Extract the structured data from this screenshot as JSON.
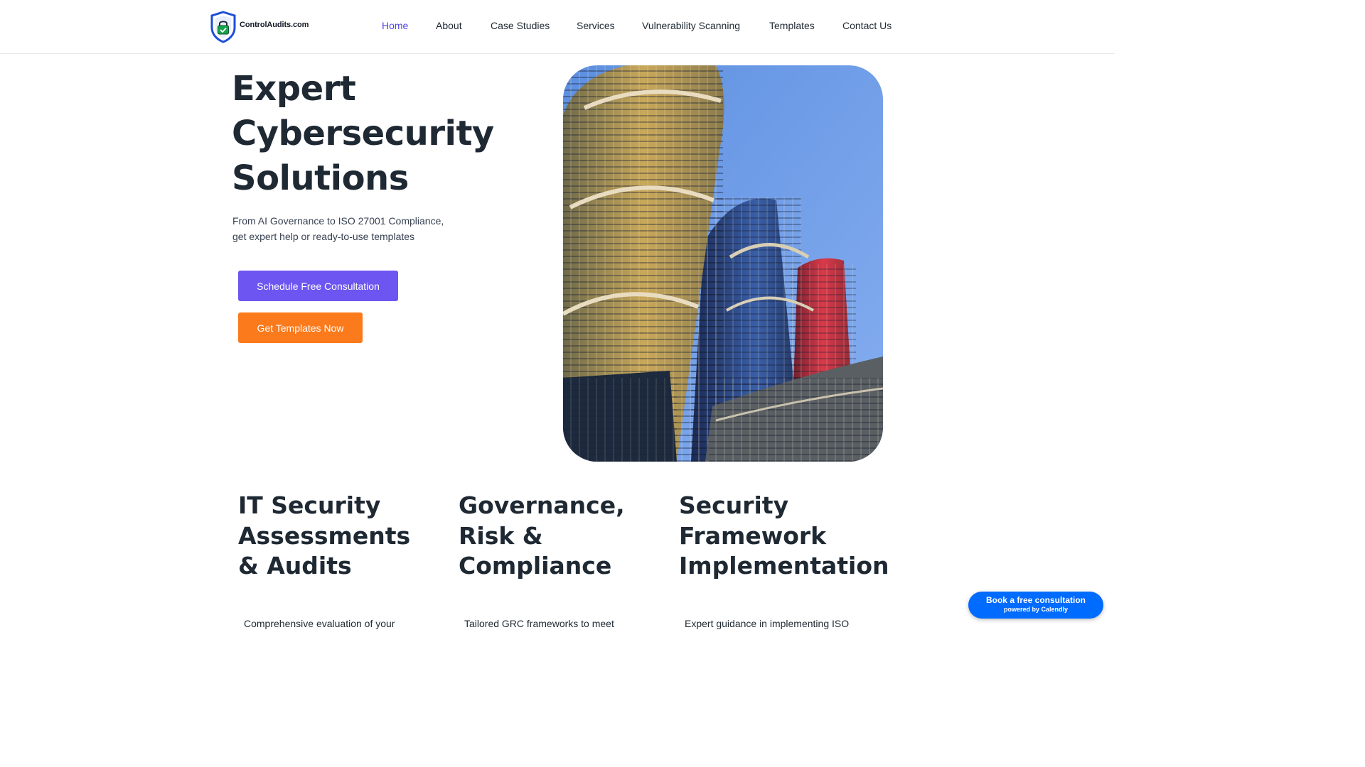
{
  "brand": {
    "name": "ControlAudits.com",
    "logo_icon": "shield-lock-icon",
    "colors": {
      "primary": "#6c55f0",
      "orange": "#fb7a1c",
      "nav_active": "#4f46e5",
      "calendly": "#006bff"
    }
  },
  "nav": {
    "items": [
      {
        "label": "Home",
        "active": true
      },
      {
        "label": "About"
      },
      {
        "label": "Case Studies"
      },
      {
        "label": "Services"
      },
      {
        "label": "Vulnerability Scanning"
      },
      {
        "label": "Templates"
      },
      {
        "label": "Contact Us"
      }
    ]
  },
  "hero": {
    "title_lines": [
      "Expert",
      "Cybersecurity",
      "Solutions"
    ],
    "subtitle_lines": [
      "From AI Governance to ISO 27001 Compliance,",
      "get expert help or ready-to-use templates"
    ],
    "primary_button": "Schedule Free Consultation",
    "secondary_button": "Get Templates Now",
    "image": "skyscrapers-photo"
  },
  "services": [
    {
      "title_lines": [
        "IT Security",
        "Assessments",
        "& Audits"
      ],
      "text": "Comprehensive evaluation of your"
    },
    {
      "title_lines": [
        "Governance,",
        "Risk &",
        "Compliance"
      ],
      "text": "Tailored GRC frameworks to meet"
    },
    {
      "title_lines": [
        "Security",
        "Framework",
        "Implementation"
      ],
      "text": "Expert guidance in implementing ISO"
    }
  ],
  "calendly": {
    "label": "Book a free consultation",
    "powered": "powered by Calendly"
  }
}
